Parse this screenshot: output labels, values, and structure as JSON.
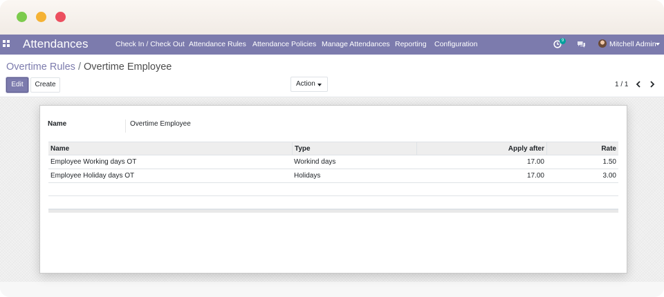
{
  "window": {
    "controls": [
      "close",
      "minimize",
      "maximize"
    ]
  },
  "navbar": {
    "apps_icon": "apps-grid-icon",
    "app_title": "Attendances",
    "menu": [
      "Check In / Check Out",
      "Attendance Rules",
      "Attendance Policies",
      "Manage Attendances",
      "Reporting",
      "Configuration"
    ],
    "activity_badge": "9",
    "user_name": "Mitchell Admin",
    "color": "#7c7bad"
  },
  "breadcrumb": {
    "parent": "Overtime Rules",
    "separator": "/",
    "current": "Overtime Employee"
  },
  "buttons": {
    "edit": "Edit",
    "create": "Create",
    "action": "Action"
  },
  "pager": {
    "value": "1 / 1"
  },
  "form": {
    "name_label": "Name",
    "name_value": "Overtime Employee",
    "table": {
      "headers": [
        "Name",
        "Type",
        "Apply after",
        "Rate"
      ],
      "rows": [
        [
          "Employee Working days OT",
          "Workind days",
          "17.00",
          "1.50"
        ],
        [
          "Employee Holiday days OT",
          "Holidays",
          "17.00",
          "3.00"
        ]
      ]
    }
  }
}
